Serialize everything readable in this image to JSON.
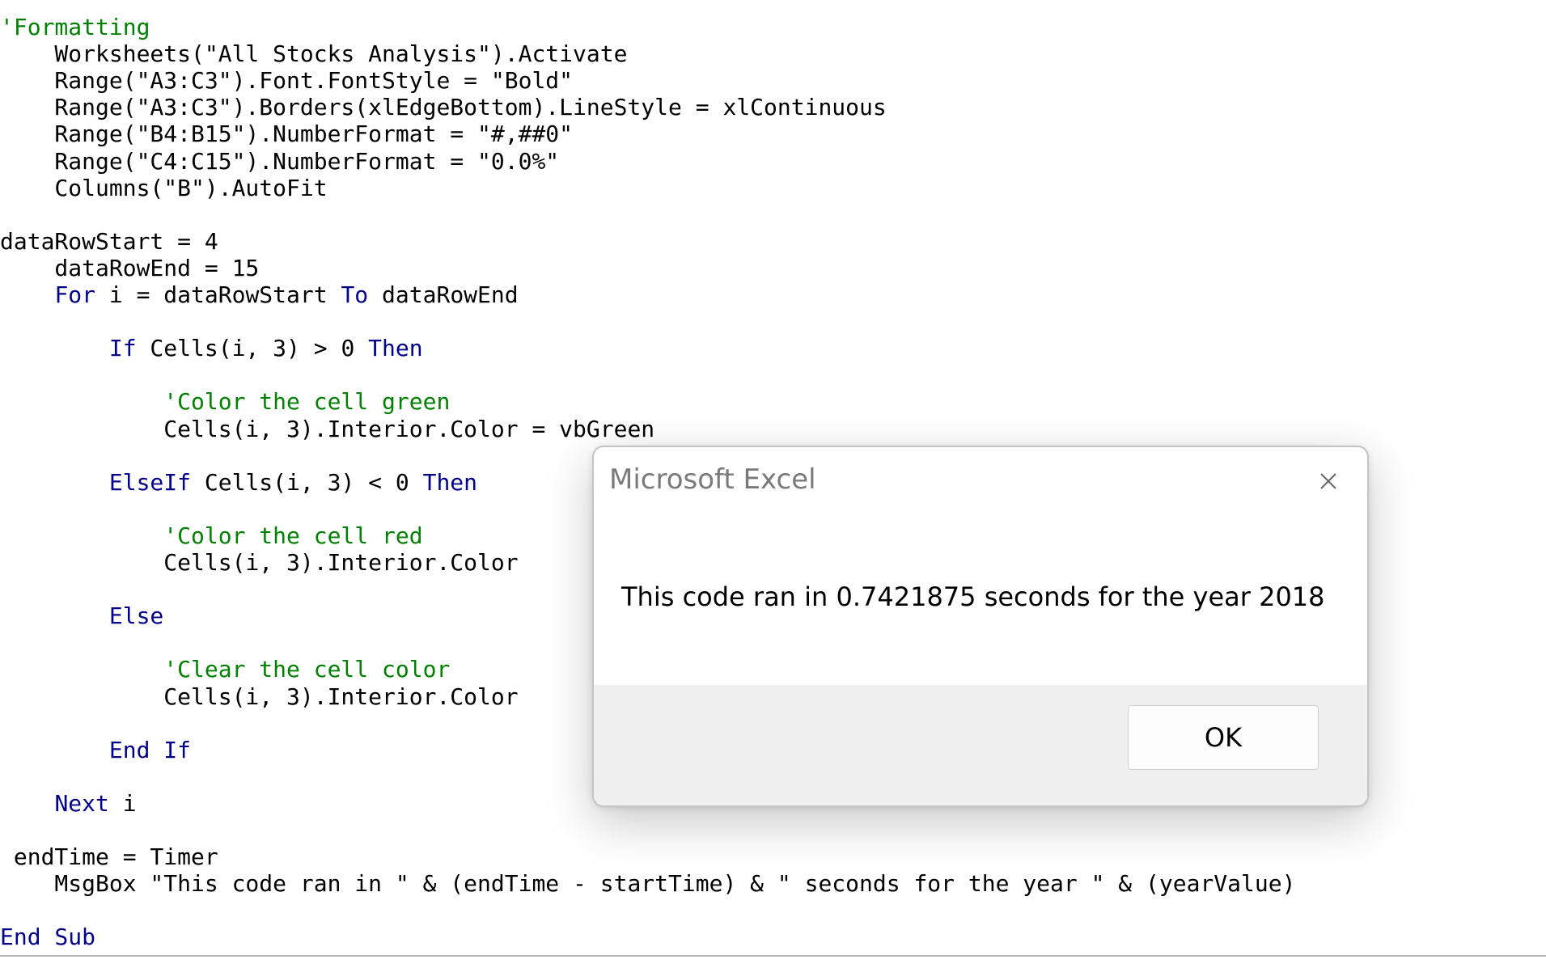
{
  "editor": {
    "lines": [
      {
        "segments": [
          {
            "t": "'Formatting",
            "c": "cm"
          }
        ]
      },
      {
        "segments": [
          {
            "t": "    Worksheets(\"All Stocks Analysis\").Activate",
            "c": ""
          }
        ]
      },
      {
        "segments": [
          {
            "t": "    Range(\"A3:C3\").Font.FontStyle = \"Bold\"",
            "c": ""
          }
        ]
      },
      {
        "segments": [
          {
            "t": "    Range(\"A3:C3\").Borders(xlEdgeBottom).LineStyle = xlContinuous",
            "c": ""
          }
        ]
      },
      {
        "segments": [
          {
            "t": "    Range(\"B4:B15\").NumberFormat = \"#,##0\"",
            "c": ""
          }
        ]
      },
      {
        "segments": [
          {
            "t": "    Range(\"C4:C15\").NumberFormat = \"0.0%\"",
            "c": ""
          }
        ]
      },
      {
        "segments": [
          {
            "t": "    Columns(\"B\").AutoFit",
            "c": ""
          }
        ]
      },
      {
        "segments": []
      },
      {
        "segments": [
          {
            "t": "dataRowStart = 4",
            "c": ""
          }
        ]
      },
      {
        "segments": [
          {
            "t": "    dataRowEnd = 15",
            "c": ""
          }
        ]
      },
      {
        "segments": [
          {
            "t": "    ",
            "c": ""
          },
          {
            "t": "For",
            "c": "kw"
          },
          {
            "t": " i = dataRowStart ",
            "c": ""
          },
          {
            "t": "To",
            "c": "kw"
          },
          {
            "t": " dataRowEnd",
            "c": ""
          }
        ]
      },
      {
        "segments": []
      },
      {
        "segments": [
          {
            "t": "        ",
            "c": ""
          },
          {
            "t": "If",
            "c": "kw"
          },
          {
            "t": " Cells(i, 3) > 0 ",
            "c": ""
          },
          {
            "t": "Then",
            "c": "kw"
          }
        ]
      },
      {
        "segments": []
      },
      {
        "segments": [
          {
            "t": "            'Color the cell green",
            "c": "cm"
          }
        ]
      },
      {
        "segments": [
          {
            "t": "            Cells(i, 3).Interior.Color = vbGreen",
            "c": ""
          }
        ]
      },
      {
        "segments": []
      },
      {
        "segments": [
          {
            "t": "        ",
            "c": ""
          },
          {
            "t": "ElseIf",
            "c": "kw"
          },
          {
            "t": " Cells(i, 3) < 0 ",
            "c": ""
          },
          {
            "t": "Then",
            "c": "kw"
          }
        ]
      },
      {
        "segments": []
      },
      {
        "segments": [
          {
            "t": "            'Color the cell red",
            "c": "cm"
          }
        ]
      },
      {
        "segments": [
          {
            "t": "            Cells(i, 3).Interior.Color",
            "c": ""
          }
        ]
      },
      {
        "segments": []
      },
      {
        "segments": [
          {
            "t": "        ",
            "c": ""
          },
          {
            "t": "Else",
            "c": "kw"
          }
        ]
      },
      {
        "segments": []
      },
      {
        "segments": [
          {
            "t": "            'Clear the cell color",
            "c": "cm"
          }
        ]
      },
      {
        "segments": [
          {
            "t": "            Cells(i, 3).Interior.Color",
            "c": ""
          }
        ]
      },
      {
        "segments": []
      },
      {
        "segments": [
          {
            "t": "        ",
            "c": ""
          },
          {
            "t": "End If",
            "c": "kw"
          }
        ]
      },
      {
        "segments": []
      },
      {
        "segments": [
          {
            "t": "    ",
            "c": ""
          },
          {
            "t": "Next",
            "c": "kw"
          },
          {
            "t": " i",
            "c": ""
          }
        ]
      },
      {
        "segments": []
      },
      {
        "segments": [
          {
            "t": " endTime = Timer",
            "c": ""
          }
        ]
      },
      {
        "segments": [
          {
            "t": "    MsgBox \"This code ran in \" & (endTime - startTime) & \" seconds for the year \" & (yearValue)",
            "c": ""
          }
        ]
      },
      {
        "segments": []
      },
      {
        "segments": [
          {
            "t": "End Sub",
            "c": "kw"
          }
        ]
      }
    ]
  },
  "dialog": {
    "title": "Microsoft Excel",
    "message": "This code ran in 0.7421875 seconds for the year 2018",
    "ok_label": "OK",
    "close_icon": "close-icon"
  },
  "colors": {
    "keyword": "#00008b",
    "comment": "#008000",
    "text": "#000000"
  }
}
